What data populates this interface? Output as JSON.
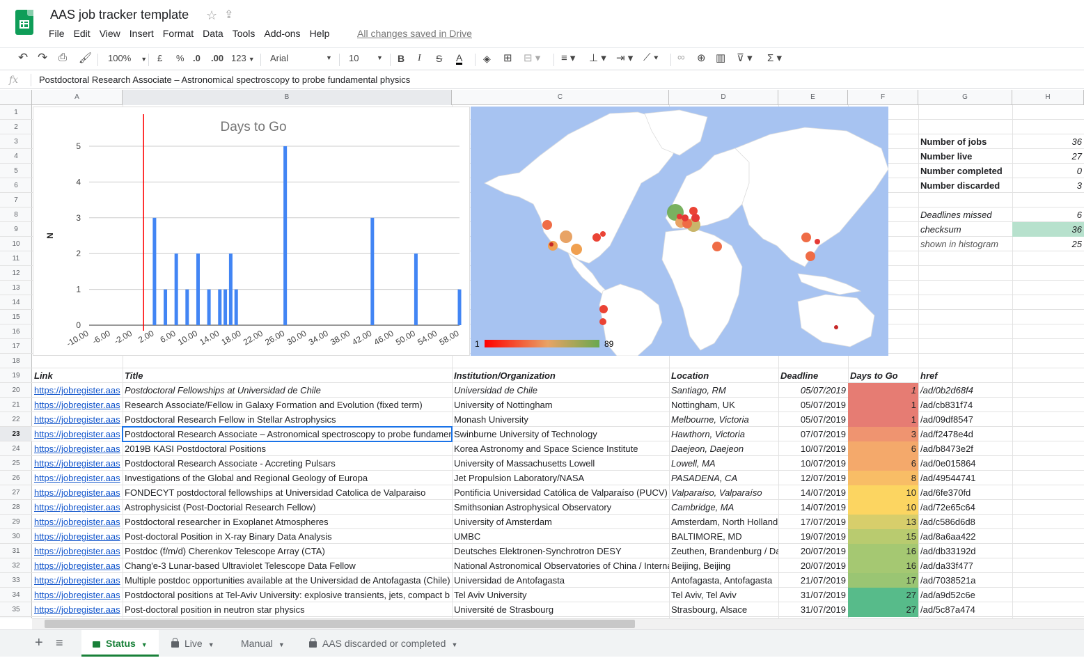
{
  "doc": {
    "title": "AAS job tracker template",
    "saved": "All changes saved in Drive"
  },
  "menu": [
    "File",
    "Edit",
    "View",
    "Insert",
    "Format",
    "Data",
    "Tools",
    "Add-ons",
    "Help"
  ],
  "toolbar": {
    "zoom": "100%",
    "currency": "£",
    "percent": "%",
    "dec_less": ".0",
    "dec_more": ".00",
    "format": "123",
    "font": "Arial",
    "size": "10"
  },
  "formula": {
    "fx": "fx",
    "value": "Postdoctoral Research Associate – Astronomical spectroscopy to probe fundamental physics"
  },
  "columns": [
    "A",
    "B",
    "C",
    "D",
    "E",
    "F",
    "G",
    "H"
  ],
  "rows": [
    "1",
    "2",
    "3",
    "4",
    "5",
    "6",
    "7",
    "8",
    "9",
    "10",
    "11",
    "12",
    "13",
    "14",
    "15",
    "16",
    "17",
    "18",
    "19",
    "20",
    "21",
    "22",
    "23",
    "24",
    "25",
    "26",
    "27",
    "28",
    "29",
    "30",
    "31",
    "32",
    "33",
    "34",
    "35"
  ],
  "summary": [
    {
      "label": "Number of jobs",
      "value": "36"
    },
    {
      "label": "Number live",
      "value": "27"
    },
    {
      "label": "Number completed",
      "value": "0"
    },
    {
      "label": "Number discarded",
      "value": "3"
    }
  ],
  "summary2": [
    {
      "label": "Deadlines missed",
      "value": "6"
    },
    {
      "label": "checksum",
      "value": "36"
    },
    {
      "label": "shown in histogram",
      "value": "25"
    }
  ],
  "headers": {
    "link": "Link",
    "title": "Title",
    "inst": "Institution/Organization",
    "loc": "Location",
    "deadline": "Deadline",
    "days": "Days to Go",
    "href": "href"
  },
  "jobs": [
    {
      "link": "https://jobregister.aas",
      "title": "Postdoctoral Fellowships at Universidad de Chile",
      "inst": "Universidad de Chile",
      "loc": "Santiago, RM",
      "deadline": "05/07/2019",
      "days": "1",
      "href": "/ad/0b2d68f4",
      "italic": true
    },
    {
      "link": "https://jobregister.aas",
      "title": "Research Associate/Fellow in Galaxy Formation and Evolution (fixed term)",
      "inst": "University of Nottingham",
      "loc": "Nottingham, UK",
      "deadline": "05/07/2019",
      "days": "1",
      "href": "/ad/cb831f74",
      "italic": false
    },
    {
      "link": "https://jobregister.aas",
      "title": "Postdoctoral Research Fellow in Stellar Astrophysics",
      "inst": "Monash University",
      "loc": "Melbourne, Victoria",
      "deadline": "05/07/2019",
      "days": "1",
      "href": "/ad/09df8547",
      "italic": false,
      "locit": true
    },
    {
      "link": "https://jobregister.aas",
      "title": "Postdoctoral Research Associate – Astronomical spectroscopy to probe fundamental physics",
      "inst": "Swinburne University of Technology",
      "loc": "Hawthorn, Victoria",
      "deadline": "07/07/2019",
      "days": "3",
      "href": "/ad/f2478e4d",
      "italic": false,
      "locit": true
    },
    {
      "link": "https://jobregister.aas",
      "title": "2019B KASI Postdoctoral Positions",
      "inst": "Korea Astronomy and Space Science Institute",
      "loc": "Daejeon, Daejeon",
      "deadline": "10/07/2019",
      "days": "6",
      "href": "/ad/b8473e2f",
      "italic": false,
      "locit": true
    },
    {
      "link": "https://jobregister.aas",
      "title": "Postdoctoral Research Associate - Accreting Pulsars",
      "inst": "University of Massachusetts Lowell",
      "loc": "Lowell, MA",
      "deadline": "10/07/2019",
      "days": "6",
      "href": "/ad/0e015864",
      "italic": false,
      "locit": true
    },
    {
      "link": "https://jobregister.aas",
      "title": "Investigations of the Global and Regional Geology of Europa",
      "inst": "Jet Propulsion Laboratory/NASA",
      "loc": "PASADENA, CA",
      "deadline": "12/07/2019",
      "days": "8",
      "href": "/ad/49544741",
      "italic": false,
      "locit": true
    },
    {
      "link": "https://jobregister.aas",
      "title": "FONDECYT postdoctoral fellowships at Universidad Catolica de Valparaiso",
      "inst": "Pontificia Universidad Católica de Valparaíso (PUCV)",
      "loc": "Valparaíso, Valparaíso",
      "deadline": "14/07/2019",
      "days": "10",
      "href": "/ad/6fe370fd",
      "italic": false,
      "locit": true
    },
    {
      "link": "https://jobregister.aas",
      "title": "Astrophysicist (Post-Doctorial Research Fellow)",
      "inst": "Smithsonian Astrophysical Observatory",
      "loc": "Cambridge, MA",
      "deadline": "14/07/2019",
      "days": "10",
      "href": "/ad/72e65c64",
      "italic": false,
      "locit": true
    },
    {
      "link": "https://jobregister.aas",
      "title": "Postdoctoral researcher in Exoplanet Atmospheres",
      "inst": "University of Amsterdam",
      "loc": "Amsterdam, North Holland",
      "deadline": "17/07/2019",
      "days": "13",
      "href": "/ad/c586d6d8",
      "italic": false
    },
    {
      "link": "https://jobregister.aas",
      "title": "Post-doctoral Position in X-ray Binary Data Analysis",
      "inst": "UMBC",
      "loc": "BALTIMORE, MD",
      "deadline": "19/07/2019",
      "days": "15",
      "href": "/ad/8a6aa422",
      "italic": false
    },
    {
      "link": "https://jobregister.aas",
      "title": "Postdoc (f/m/d) Cherenkov Telescope Array (CTA)",
      "inst": "Deutsches Elektronen-Synchrotron DESY",
      "loc": "Zeuthen, Brandenburg / Da",
      "deadline": "20/07/2019",
      "days": "16",
      "href": "/ad/db33192d",
      "italic": false
    },
    {
      "link": "https://jobregister.aas",
      "title": "Chang'e-3 Lunar-based Ultraviolet Telescope Data Fellow",
      "inst": "National Astronomical Observatories of China / Interna",
      "loc": "Beijing, Beijing",
      "deadline": "20/07/2019",
      "days": "16",
      "href": "/ad/da33f477",
      "italic": false
    },
    {
      "link": "https://jobregister.aas",
      "title": "Multiple postdoc opportunities available at the Universidad de Antofagasta (Chile)",
      "inst": "Universidad de Antofagasta",
      "loc": "Antofagasta, Antofagasta",
      "deadline": "21/07/2019",
      "days": "17",
      "href": "/ad/7038521a",
      "italic": false
    },
    {
      "link": "https://jobregister.aas",
      "title": "Postdoctoral positions at Tel-Aviv University: explosive transients, jets, compact b",
      "inst": "Tel Aviv University",
      "loc": "Tel Aviv, Tel Aviv",
      "deadline": "31/07/2019",
      "days": "27",
      "href": "/ad/a9d52c6e",
      "italic": false
    },
    {
      "link": "https://jobregister.aas",
      "title": "Post-doctoral position in neutron star physics",
      "inst": "Université de Strasbourg",
      "loc": "Strasbourg, Alsace",
      "deadline": "31/07/2019",
      "days": "27",
      "href": "/ad/5c87a474",
      "italic": false
    }
  ],
  "day_colors": [
    "#e67c73",
    "#e67c73",
    "#e67c73",
    "#ef9470",
    "#f4a96b",
    "#f4a96b",
    "#f8bd66",
    "#fcd561",
    "#fcd561",
    "#d7ce6b",
    "#b9cb6f",
    "#a5c872",
    "#a5c872",
    "#9ac573",
    "#57bb8a",
    "#57bb8a"
  ],
  "chart_data": {
    "type": "bar",
    "title": "Days to Go",
    "ylabel": "N",
    "xlabel": "",
    "x": [
      2,
      4,
      6,
      8,
      10,
      12,
      14,
      15,
      16,
      17,
      26,
      42,
      50,
      58
    ],
    "values": [
      3,
      1,
      2,
      1,
      2,
      1,
      1,
      1,
      2,
      1,
      5,
      3,
      2,
      1
    ],
    "xticks": [
      "-10.00",
      "-6.00",
      "-2.00",
      "2.00",
      "6.00",
      "10.00",
      "14.00",
      "18.00",
      "22.00",
      "26.00",
      "30.00",
      "34.00",
      "38.00",
      "42.00",
      "46.00",
      "50.00",
      "54.00",
      "58.00"
    ],
    "xlim": [
      -10,
      58
    ],
    "yticks": [
      "0",
      "1",
      "2",
      "3",
      "4",
      "5"
    ],
    "ylim": [
      0,
      5
    ],
    "marker_x": 0,
    "bar_color": "#4285f4",
    "marker_color": "#ff0000",
    "grid": true
  },
  "map": {
    "legend_min": "1",
    "legend_max": "89",
    "land": "#ffffff",
    "water": "#a7c3f1"
  },
  "sheets": [
    {
      "label": "Status",
      "active": true,
      "locked": false
    },
    {
      "label": "Live",
      "active": false,
      "locked": true
    },
    {
      "label": "Manual",
      "active": false,
      "locked": false
    },
    {
      "label": "AAS discarded or completed",
      "active": false,
      "locked": true
    }
  ]
}
